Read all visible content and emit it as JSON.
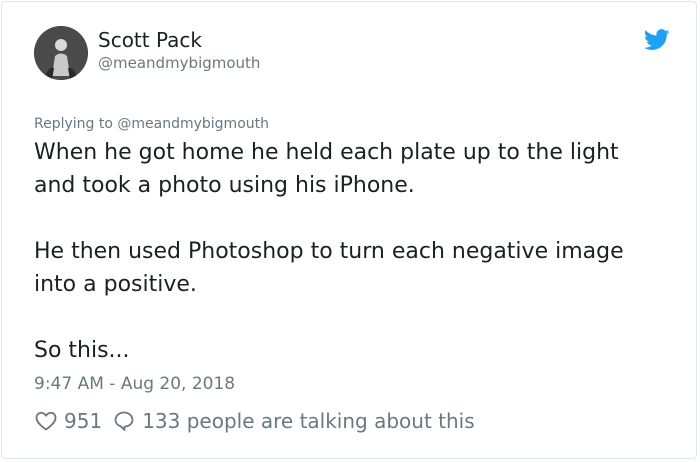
{
  "tweet": {
    "author_name": "Scott Pack",
    "author_handle": "@meandmybigmouth",
    "replying_to": "Replying to @meandmybigmouth",
    "paragraphs": [
      "When he got home he held each plate up to the light and took a photo using his iPhone.",
      "He then used Photoshop to turn each negative image into a positive.",
      "So this..."
    ],
    "timestamp": "9:47 AM - Aug 20, 2018",
    "like_count": "951",
    "talking_text": "133 people are talking about this"
  },
  "icons": {
    "brand": "twitter-bird-icon",
    "like": "heart-icon",
    "reply": "speech-bubble-icon"
  },
  "colors": {
    "brand_blue": "#1da1f2",
    "text_primary": "#1c2022",
    "text_secondary": "#697882",
    "border": "#e1e8ed"
  }
}
